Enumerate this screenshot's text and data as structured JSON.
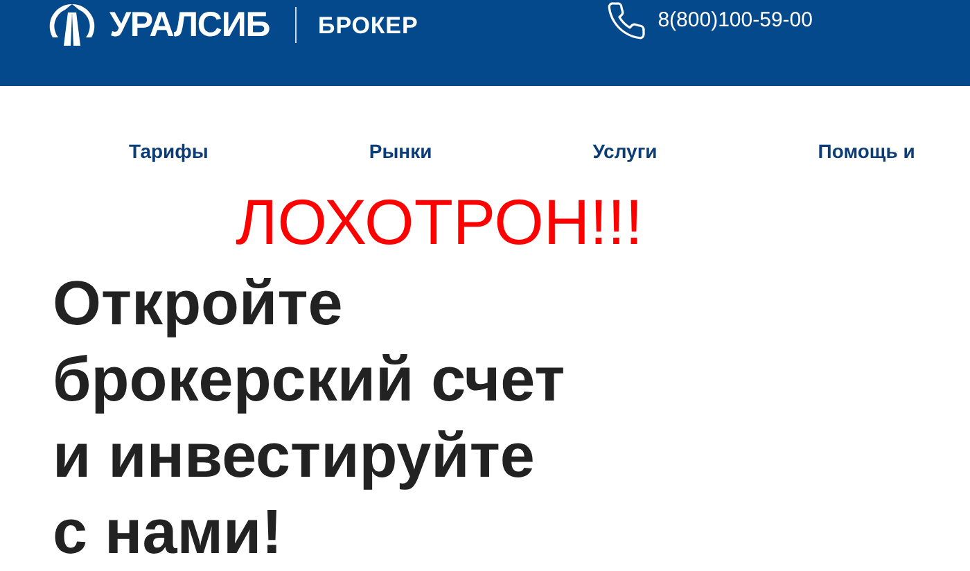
{
  "header": {
    "logo_text": "УРАЛСИБ",
    "product": "БРОКЕР",
    "phone": "8(800)100-59-00"
  },
  "nav": [
    {
      "label": "Тарифы"
    },
    {
      "label": "Рынки"
    },
    {
      "label": "Услуги"
    },
    {
      "label": "Помощь и"
    }
  ],
  "overlay_text": "ЛОХОТРОН!!!",
  "hero": {
    "heading_lines": [
      "Откройте",
      "брокерский счет",
      "и инвестируйте",
      "с нами!"
    ]
  }
}
